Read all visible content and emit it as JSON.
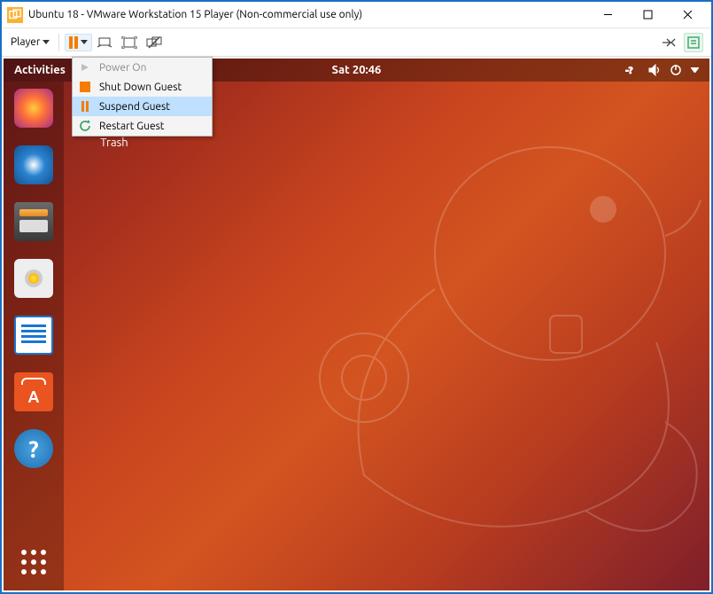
{
  "window": {
    "title": "Ubuntu 18 - VMware Workstation 15 Player (Non-commercial use only)"
  },
  "toolbar": {
    "player_label": "Player"
  },
  "dropdown": {
    "items": [
      {
        "label": "Power On",
        "icon": "play-icon",
        "disabled": true,
        "highlighted": false
      },
      {
        "label": "Shut Down Guest",
        "icon": "stop-icon",
        "disabled": false,
        "highlighted": false
      },
      {
        "label": "Suspend Guest",
        "icon": "pause-icon",
        "disabled": false,
        "highlighted": true
      },
      {
        "label": "Restart Guest",
        "icon": "restart-icon",
        "disabled": false,
        "highlighted": false
      }
    ]
  },
  "ubuntu": {
    "activities_label": "Activities",
    "clock": "Sat 20:46",
    "desktop": {
      "trash_label": "Trash"
    }
  }
}
